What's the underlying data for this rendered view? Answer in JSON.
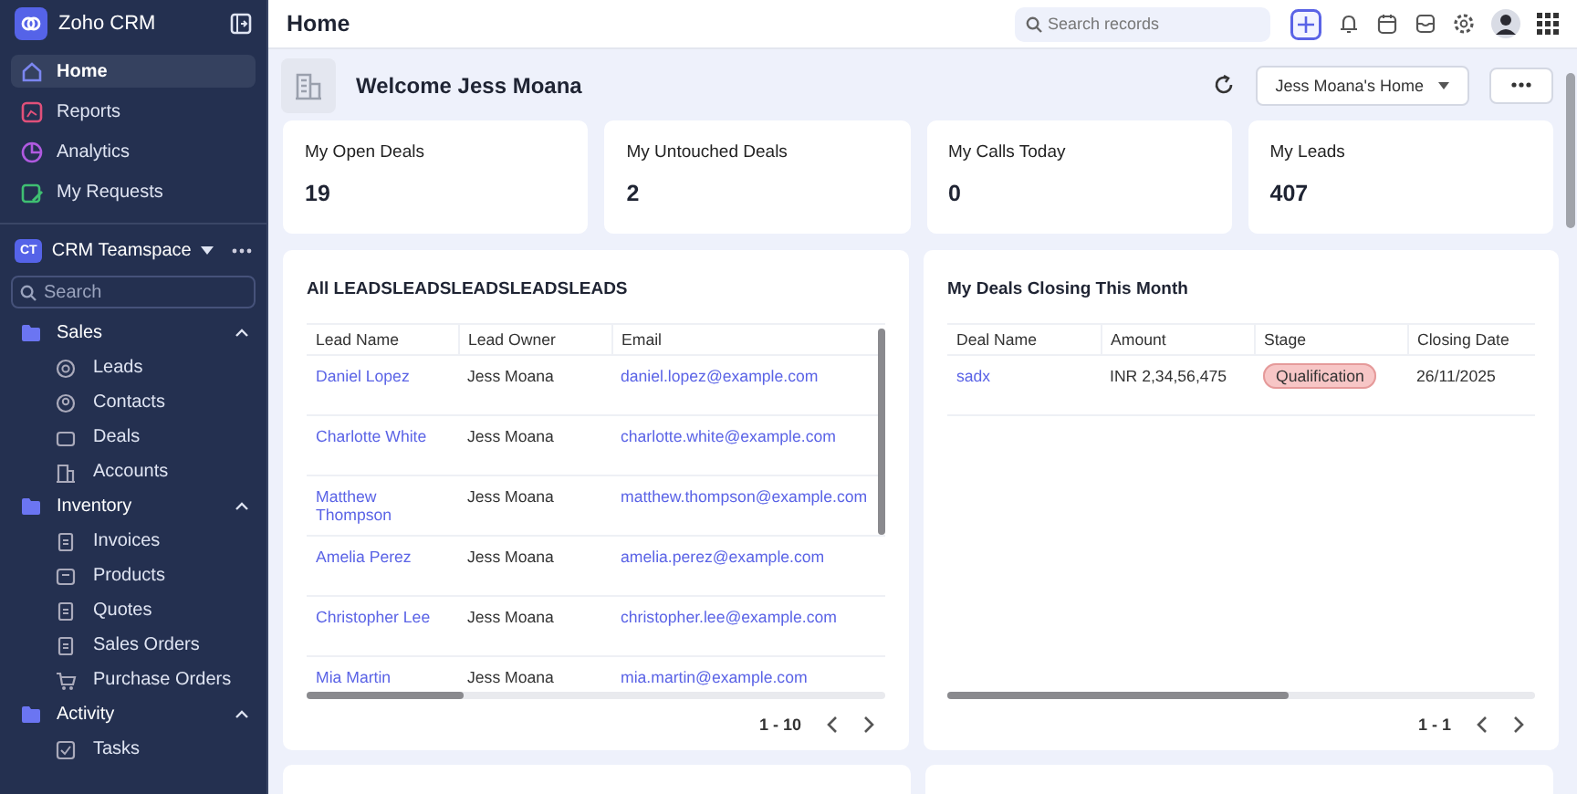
{
  "app": {
    "name": "Zoho CRM"
  },
  "nav": [
    {
      "label": "Home",
      "selected": true
    },
    {
      "label": "Reports",
      "selected": false
    },
    {
      "label": "Analytics",
      "selected": false
    },
    {
      "label": "My Requests",
      "selected": false
    }
  ],
  "teamspace": {
    "badge": "CT",
    "name": "CRM Teamspace",
    "search": {
      "placeholder": "Search"
    }
  },
  "modules": [
    {
      "label": "Sales",
      "expanded": true,
      "children": [
        {
          "label": "Leads"
        },
        {
          "label": "Contacts"
        },
        {
          "label": "Deals"
        },
        {
          "label": "Accounts"
        }
      ]
    },
    {
      "label": "Inventory",
      "expanded": true,
      "children": [
        {
          "label": "Invoices"
        },
        {
          "label": "Products"
        },
        {
          "label": "Quotes"
        },
        {
          "label": "Sales Orders"
        },
        {
          "label": "Purchase Orders"
        }
      ]
    },
    {
      "label": "Activity",
      "expanded": true,
      "children": [
        {
          "label": "Tasks"
        }
      ]
    }
  ],
  "topbar": {
    "title": "Home",
    "search": {
      "placeholder": "Search records"
    }
  },
  "welcome": {
    "text": "Welcome Jess Moana",
    "view": "Jess Moana's Home"
  },
  "stats": [
    {
      "label": "My Open Deals",
      "value": "19"
    },
    {
      "label": "My Untouched Deals",
      "value": "2"
    },
    {
      "label": "My Calls Today",
      "value": "0"
    },
    {
      "label": "My Leads",
      "value": "407"
    }
  ],
  "leads": {
    "title": "All LEADSLEADSLEADSLEADSLEADS",
    "columns": [
      "Lead Name",
      "Lead Owner",
      "Email"
    ],
    "rows": [
      [
        "Daniel Lopez",
        "Jess Moana",
        "daniel.lopez@example.com"
      ],
      [
        "Charlotte White",
        "Jess Moana",
        "charlotte.white@example.com"
      ],
      [
        "Matthew Thompson",
        "Jess Moana",
        "matthew.thompson@example.com"
      ],
      [
        "Amelia Perez",
        "Jess Moana",
        "amelia.perez@example.com"
      ],
      [
        "Christopher Lee",
        "Jess Moana",
        "christopher.lee@example.com"
      ],
      [
        "Mia Martin",
        "Jess Moana",
        "mia.martin@example.com"
      ]
    ],
    "range": "1 - 10"
  },
  "deals": {
    "title": "My Deals Closing This Month",
    "columns": [
      "Deal Name",
      "Amount",
      "Stage",
      "Closing Date"
    ],
    "rows": [
      {
        "name": "sadx",
        "amount": "INR 2,34,56,475",
        "stage": "Qualification",
        "date": "26/11/2025"
      }
    ],
    "range": "1 - 1"
  }
}
